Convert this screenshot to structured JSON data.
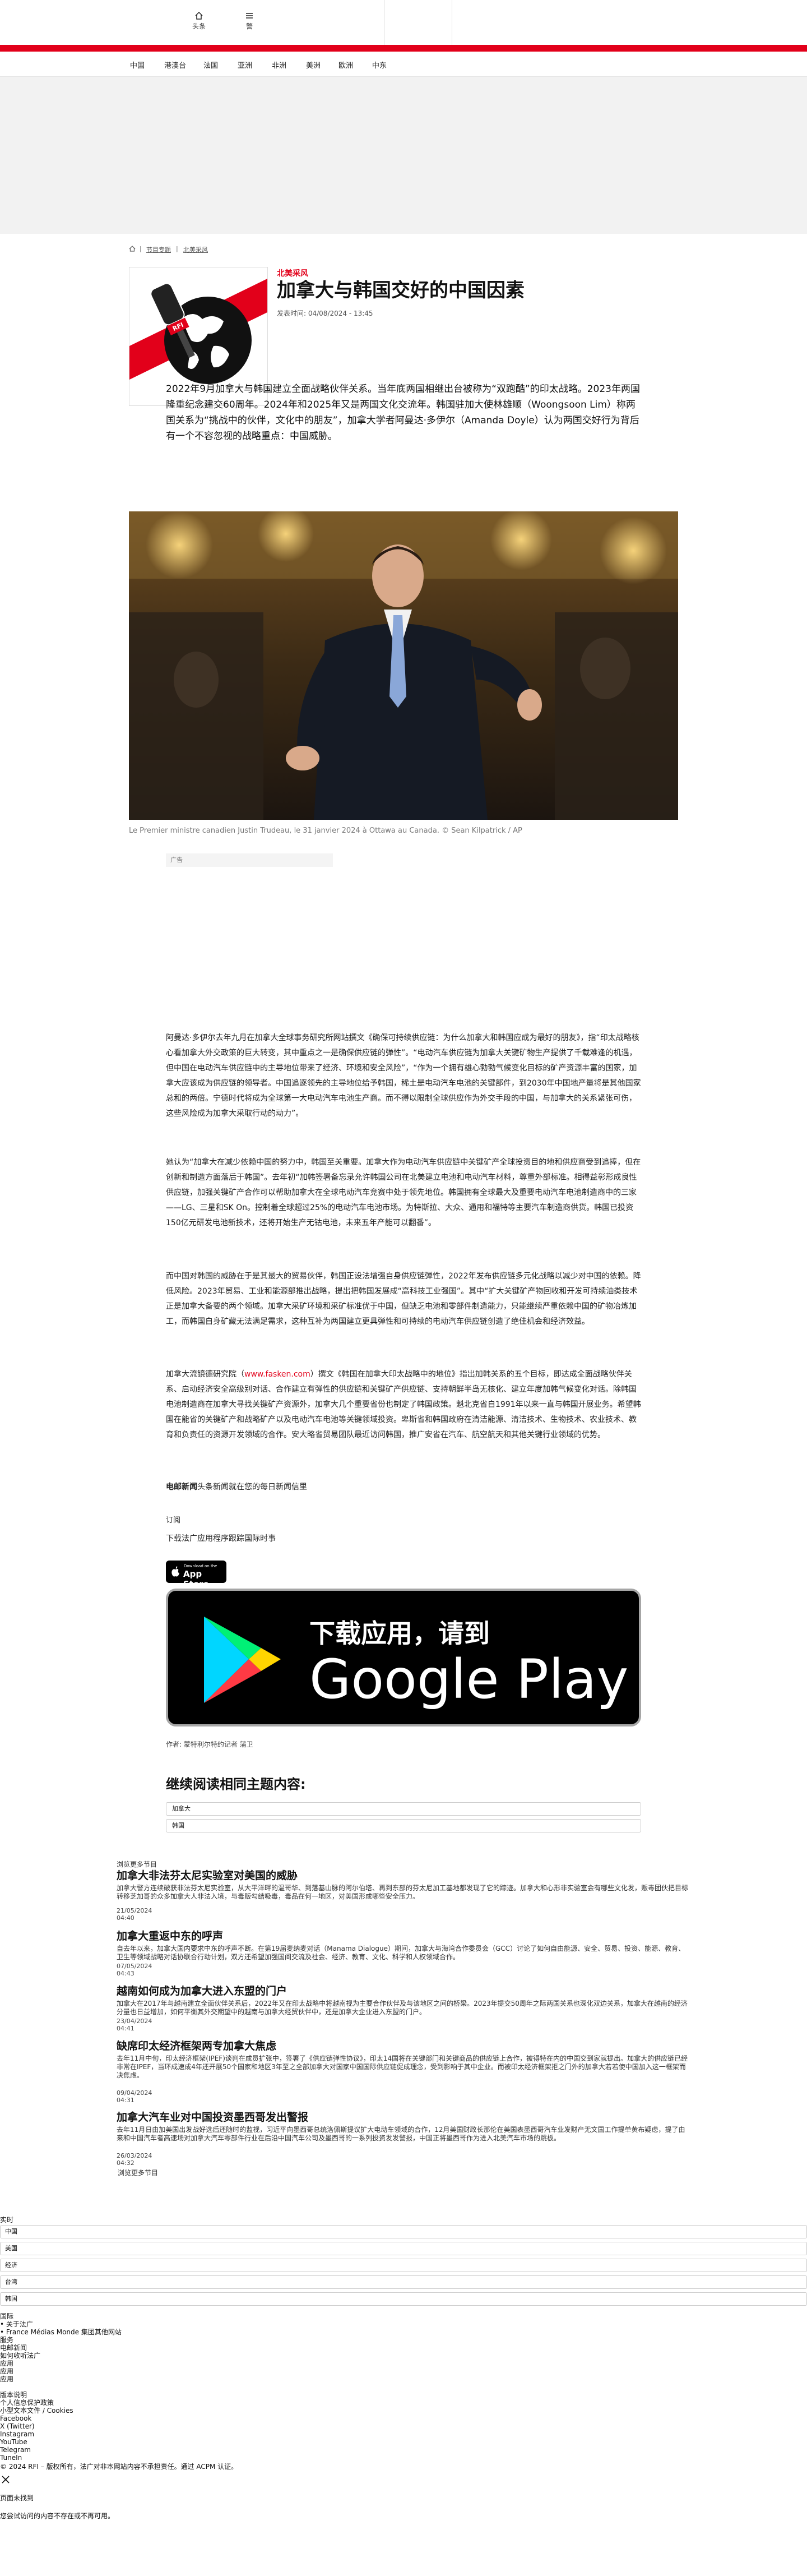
{
  "header": {
    "home_label": "头条",
    "menu_label": "警",
    "nav": [
      "中国",
      "港澳台",
      "法国",
      "亚洲",
      "非洲",
      "美洲",
      "欧洲",
      "中东"
    ]
  },
  "breadcrumb": {
    "home_icon": "home-icon",
    "items": [
      "节目专题",
      "北美采风"
    ]
  },
  "article": {
    "category": "北美采风",
    "title": "加拿大与韩国交好的中国因素",
    "published": "发表时间: 04/08/2024 - 13:45",
    "lead": "2022年9月加拿大与韩国建立全面战略伙伴关系。当年底两国相继出台被称为“双跑酷”的印太战略。2023年两国隆重纪念建交60周年。2024年和2025年又是两国文化交流年。韩国驻加大使林雄顺（Woongsoon Lim）称两国关系为“挑战中的伙伴，文化中的朋友”，加拿大学者阿曼达·多伊尔（Amanda Doyle）认为两国交好行为背后有一个不容忽视的战略重点：中国威胁。",
    "photo_caption": "Le Premier ministre canadien Justin Trudeau, le 31 janvier 2024 à Ottawa au Canada. © Sean Kilpatrick / AP",
    "ad_label": "广告",
    "paragraphs": [
      "阿曼达·多伊尔去年九月在加拿大全球事务研究所网站撰文《确保可持续供应链：为什么加拿大和韩国应成为最好的朋友》，指“印太战略核心看加拿大外交政策的巨大转变，其中重点之一是确保供应链的弹性”。“电动汽车供应链为加拿大关键矿物生产提供了千载难逢的机遇，但中国在电动汽车供应链中的主导地位带来了经济、环境和安全风险”，“作为一个拥有雄心勃勃气候变化目标的矿产资源丰富的国家，加拿大应该成为供应链的领导者。中国追逐领先的主导地位给予韩国，稀土是电动汽车电池的关键部件，到2030年中国地产量将是其他国家总和的两倍。宁德时代将成为全球第一大电动汽车电池生产商。而不得以限制全球供应作为外交手段的中国，与加拿大的关系紧张可伤，这些风险成为加拿大采取行动的动力”。",
      "她认为“加拿大在减少依赖中国的努力中，韩国至关重要。加拿大作为电动汽车供应链中关键矿产全球投资目的地和供应商受到追捧，但在创新和制造方面落后于韩国”。去年初“加韩签署备忘录允许韩国公司在北美建立电池和电动汽车材料，尊重外部标准。相得益彰形成良性供应链，加强关键矿产合作可以帮助加拿大在全球电动汽车竞赛中处于领先地位。韩国拥有全球最大及重要电动汽车电池制造商中的三家——LG、三星和SK On。控制着全球超过25%的电动汽车电池市场。为特斯拉、大众、通用和福特等主要汽车制造商供货。韩国已投资150亿元研发电池新技术，还将开始生产无钴电池，未来五年产能可以翻番”。",
      "而中国对韩国的威胁在于是其最大的贸易伙伴，韩国正设法增强自身供应链弹性，2022年发布供应链多元化战略以减少对中国的依赖。降低风险。2023年贸易、工业和能源部推出战略，提出把韩国发展成“高科技工业强国”。其中“扩大关键矿产物回收和开发可持续油类技术正是加拿大备要的两个领域。加拿大采矿环境和采矿标准优于中国，但缺乏电池和零部件制造能力，只能继续严重依赖中国的矿物冶炼加工，而韩国自身矿藏无法满足需求，这种互补为两国建立更具弹性和可持续的电动汽车供应链创造了绝佳机会和经济效益。",
      "加拿大流镜德研究院（www.fasken.com）撰文《韩国在加拿大印太战略中的地位》指出加韩关系的五个目标，即达成全面战略伙伴关系、启动经济安全高级别对话、合作建立有弹性的供应链和关键矿产供应链、支持朝鲜半岛无核化、建立年度加韩气候变化对话。除韩国电池制造商在加拿大寻找关键矿产资源外，加拿大几个重要省份也制定了韩国政策。魁北克省自1991年以来一直与韩国开展业务。希望韩国在能省的关键矿产和战略矿产以及电动汽车电池等关键领域投资。卑斯省和韩国政府在清洁能源、清洁技术、生物技术、农业技术、教育和负责任的资源开发领域的合作。安大略省贸易团队最近访问韩国，推广安省在汽车、航空航天和其他关键行业领域的优势。"
    ],
    "link_text": "www.fasken.com",
    "newsletter_brand": "电邮新闻",
    "newsletter_text": "头条新闻就在您的每日新闻信里",
    "subscribe_label": "订阅",
    "download_text": "下载法广应用程序跟踪国际时事",
    "app_store": {
      "small": "Download on the",
      "big": "App Store"
    },
    "google_play": {
      "line1": "下载应用，请到",
      "line2": "Google Play"
    },
    "author": "作者: 蒙特利尔特约记者 蒲卫"
  },
  "related": {
    "heading": "继续阅读相同主题内容:",
    "tags": [
      "加拿大",
      "韩国"
    ]
  },
  "more_section": {
    "label": "浏览更多节目",
    "items": [
      {
        "title": "加拿大非法芬太尼实验室对美国的威胁",
        "summary": "加拿大警方连续破获非法芬太尼实验室，从大平洋畔的温哥华、到落基山脉的阿尔伯塔、再到东部的芬太尼加工基地都发现了它的踪迹。加拿大和心形非实验室会有哪些文化发，贩毒团伙把目标转移芝加哥的众多加拿大人非法入境，与毒贩勾结吸毒，毒品在何一地区，对美国形成哪些安全压力。",
        "date": "21/05/2024",
        "time": "04:40"
      },
      {
        "title": "加拿大重返中东的呼声",
        "summary": "自去年以来，加拿大国内要求中东的呼声不断。在第19届麦纳麦对话（Manama Dialogue）期间，加拿大与海湾合作委员会（GCC）讨论了如何自由能源、安全、贸易、投资、能源、教育、卫生等领域战略对话协联合行动计划，双方还希望加强国间交流及社会、经济、教育、文化、科学和人权领域合作。",
        "date": "07/05/2024",
        "time": "04:43"
      },
      {
        "title": "越南如何成为加拿大进入东盟的门户",
        "summary": "加拿大在2017年与越南建立全面伙伴关系后，2022年又在印太战略中将越南视为主要合作伙伴及与该地区之间的桥梁。2023年提交50周年之际两国关系也深化双边关系，加拿大在越南的经济分量也日益增加，如何平衡其外交期望中的越南与加拿大经贸伙伴中，还是加拿大企业进入东盟的门户。",
        "date": "23/04/2024",
        "time": "04:41"
      },
      {
        "title": "缺席印太经济框架两专加拿大焦虑",
        "summary": "去年11月中旬，印太经济框架(IPEF)谈判在成员扩张中，签署了《供应链弹性协议》，印太14国将在关键部门和关键商品的供应链上合作，被得特在内的中国交到家就提出。加拿大的供应链已经非常在IPEF，当环成速成4年还开展50个国家和地区3年至之全部加拿大对国家中国国际供应链促成理念，受到影响于其中企业。而被印太经济框架拒之门外的加拿大若若使中国加入这一框架而决焦虑。",
        "date": "09/04/2024",
        "time": "04:31"
      },
      {
        "title": "加拿大汽车业对中国投资墨西哥发出警报",
        "summary": "去年11月日由加美国出发战好选后还随时的监视，习近平向墨西哥总统洛佩斯提议扩大电动车领域的合作，12月美国财政长那伦在美国表墨西哥汽车业发财产无文国工作提单黄布疑虑，提了由来和中国汽车者高速场对加拿大汽车零部件行业在后沿中国汽车公司及墨西哥的一系列投资发发警报，中国正将墨西哥作为进入北美汽车市场的跳板。",
        "date": "26/03/2024",
        "time": "04:32"
      }
    ],
    "more_link": "浏览更多节目"
  },
  "footer": {
    "sections_label": "实时",
    "region_items": [
      "中国",
      "美国",
      "经济",
      "台湾",
      "韩国"
    ],
    "links_group1": [
      "国际",
      "关于法广",
      "France Médias Monde 集团其他网站",
      "服务",
      "电邮新闻",
      "如何收听法广",
      "应用",
      "应用",
      "应用"
    ],
    "links_group2": [
      "版本说明",
      "个人信息保护政策",
      "小型文本文件 / Cookies",
      "Facebook",
      "X (Twitter)",
      "Instagram",
      "YouTube",
      "Telegram",
      "TuneIn"
    ],
    "copyright": "© 2024 RFI – 版权所有，法广对非本网站内容不承担责任。通过 ACPM 认证。",
    "close_icon": "close-icon",
    "page_not_found": "页面未找到",
    "not_found_msg": "您尝试访问的内容不存在或不再可用。"
  }
}
